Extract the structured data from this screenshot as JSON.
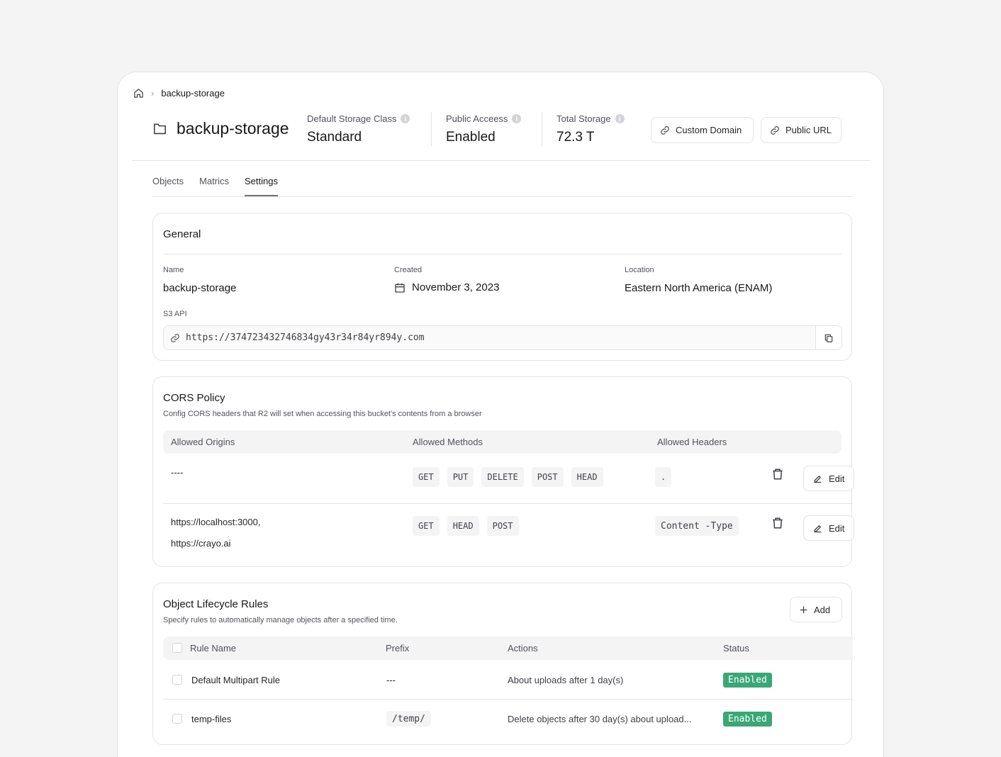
{
  "breadcrumb": {
    "current": "backup-storage"
  },
  "header": {
    "title": "backup-storage",
    "stats": [
      {
        "label": "Default Storage Class",
        "value": "Standard"
      },
      {
        "label": "Public Acceess",
        "value": "Enabled"
      },
      {
        "label": "Total Storage",
        "value": "72.3 T"
      }
    ],
    "buttons": {
      "custom_domain": "Custom Domain",
      "public_url": "Public URL"
    }
  },
  "tabs": [
    {
      "label": "Objects"
    },
    {
      "label": "Matrics"
    },
    {
      "label": "Settings",
      "active": true
    }
  ],
  "general": {
    "title": "General",
    "name_label": "Name",
    "name_value": "backup-storage",
    "created_label": "Created",
    "created_value": "November 3, 2023",
    "location_label": "Location",
    "location_value": "Eastern North America (ENAM)",
    "s3_label": "S3 API",
    "s3_url": "https://374723432746834gy43r34r84yr894y.com"
  },
  "cors": {
    "title": "CORS Policy",
    "subtitle": "Config CORS headers that R2 will set when accessing this bucket's contents from a browser",
    "headers": {
      "origins": "Allowed Origins",
      "methods": "Allowed Methods",
      "allowed_headers": "Allowed Headers"
    },
    "rows": [
      {
        "origins": [
          "----"
        ],
        "methods": [
          "GET",
          "PUT",
          "DELETE",
          "POST",
          "HEAD"
        ],
        "headers": ".",
        "edit": "Edit"
      },
      {
        "origins": [
          "https://localhost:3000,",
          "https://crayo.ai"
        ],
        "methods": [
          "GET",
          "HEAD",
          "POST"
        ],
        "headers": "Content -Type",
        "edit": "Edit"
      }
    ]
  },
  "lifecycle": {
    "title": "Object Lifecycle Rules",
    "subtitle": "Specify rules to automatically manage objects after a specified time.",
    "add_label": "Add",
    "headers": {
      "rule_name": "Rule Name",
      "prefix": "Prefix",
      "actions": "Actions",
      "status": "Status"
    },
    "rows": [
      {
        "name": "Default Multipart Rule",
        "prefix": "---",
        "action": "About uploads after 1 day(s)",
        "status": "Enabled"
      },
      {
        "name": "temp-files",
        "prefix": "/temp/",
        "action": "Delete objects after 30 day(s) about upload...",
        "status": "Enabled"
      }
    ]
  },
  "colors": {
    "accent_green": "#3aa776",
    "border": "#e4e4e7"
  }
}
